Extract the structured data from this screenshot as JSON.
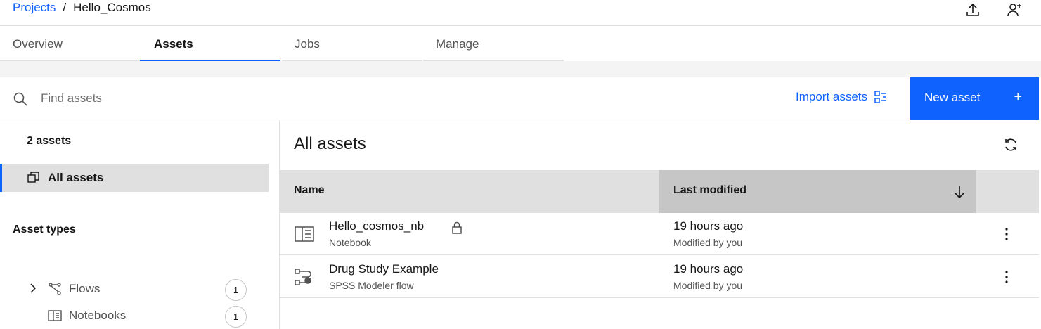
{
  "breadcrumb": {
    "projects": "Projects",
    "separator": "/",
    "current": "Hello_Cosmos"
  },
  "header_icons": [
    "upload-icon",
    "add-user-icon"
  ],
  "tabs": [
    {
      "label": "Overview",
      "active": false
    },
    {
      "label": "Assets",
      "active": true
    },
    {
      "label": "Jobs",
      "active": false
    },
    {
      "label": "Manage",
      "active": false
    }
  ],
  "search": {
    "placeholder": "Find assets",
    "value": ""
  },
  "toolbar": {
    "import_label": "Import assets",
    "new_asset_label": "New asset",
    "new_asset_icon": "+"
  },
  "sidebar": {
    "asset_count": "2 assets",
    "all_assets": "All assets",
    "asset_types_title": "Asset types",
    "types": [
      {
        "label": "Flows",
        "count": "1",
        "icon": "flows-icon",
        "expandable": true
      },
      {
        "label": "Notebooks",
        "count": "1",
        "icon": "notebook-icon",
        "expandable": false
      }
    ]
  },
  "main": {
    "title": "All assets",
    "columns": {
      "name": "Name",
      "last_modified": "Last modified"
    },
    "sort": "descending",
    "rows": [
      {
        "name": "Hello_cosmos_nb",
        "type": "Notebook",
        "modified": "19 hours ago",
        "modified_by": "Modified by you",
        "locked": true,
        "icon": "notebook-icon"
      },
      {
        "name": "Drug Study Example",
        "type": "SPSS Modeler flow",
        "modified": "19 hours ago",
        "modified_by": "Modified by you",
        "locked": false,
        "icon": "modeler-flow-icon"
      }
    ]
  },
  "colors": {
    "accent": "#0f62fe",
    "header_bg": "#e0e0e0",
    "sorted_col_bg": "#c6c6c6"
  }
}
